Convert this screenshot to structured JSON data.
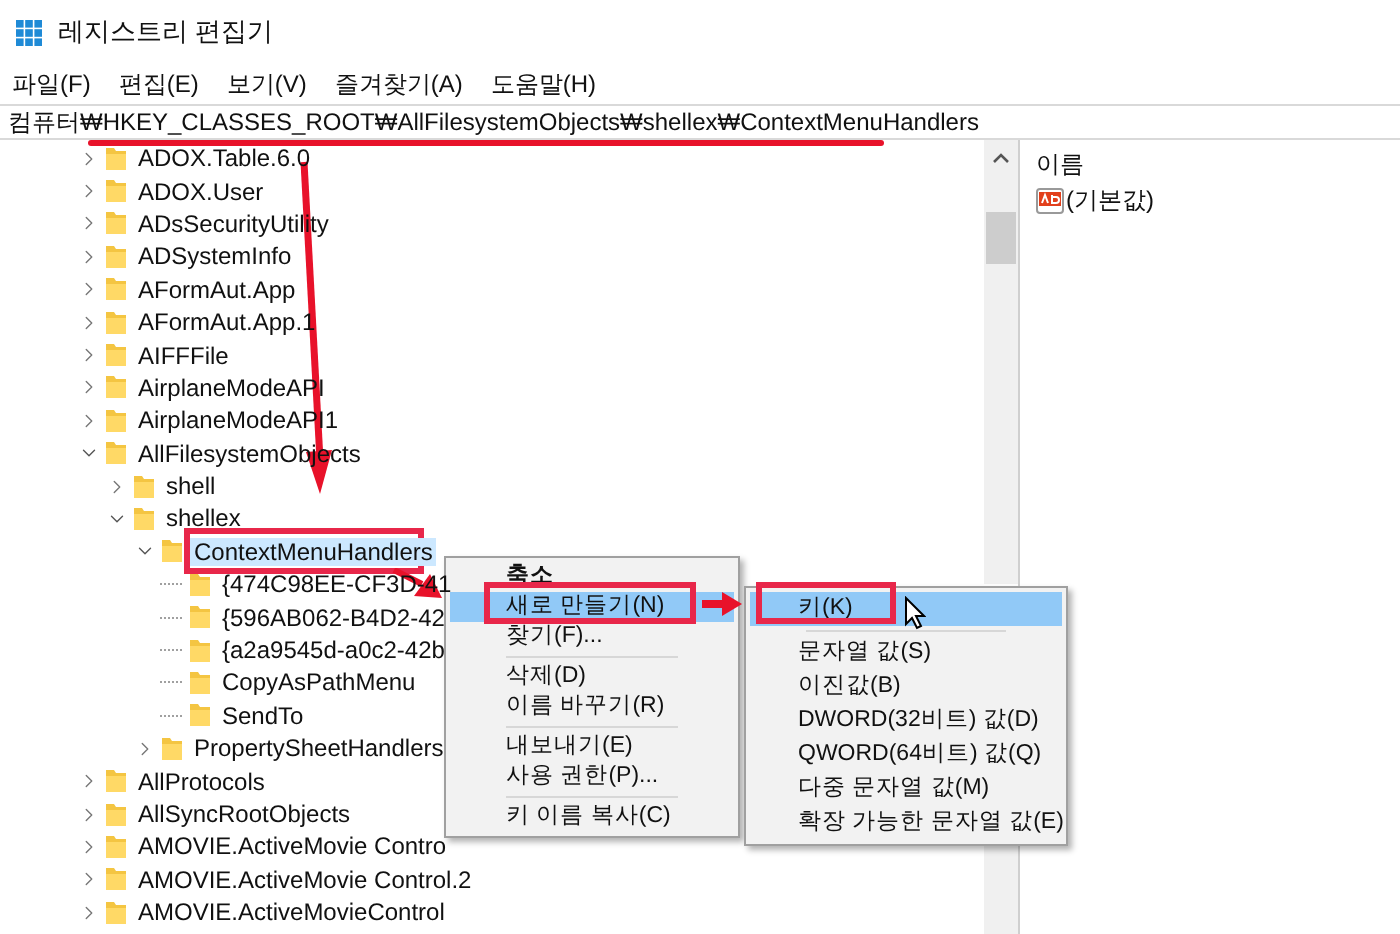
{
  "window": {
    "title": "레지스트리 편집기"
  },
  "menu_bar": [
    "파일(F)",
    "편집(E)",
    "보기(V)",
    "즐겨찾기(A)",
    "도움말(H)"
  ],
  "address": "컴퓨터₩HKEY_CLASSES_ROOT₩AllFilesystemObjects₩shellex₩ContextMenuHandlers",
  "tree": {
    "items": [
      {
        "label": "ADOX.Table.6.0",
        "kind": "branch",
        "expanded": false,
        "selected": false
      },
      {
        "label": "ADOX.User",
        "kind": "branch",
        "expanded": false,
        "selected": false
      },
      {
        "label": "ADsSecurityUtility",
        "kind": "branch",
        "expanded": false,
        "selected": false
      },
      {
        "label": "ADSystemInfo",
        "kind": "branch",
        "expanded": false,
        "selected": false
      },
      {
        "label": "AFormAut.App",
        "kind": "branch",
        "expanded": false,
        "selected": false
      },
      {
        "label": "AFormAut.App.1",
        "kind": "branch",
        "expanded": false,
        "selected": false
      },
      {
        "label": "AIFFFile",
        "kind": "branch",
        "expanded": false,
        "selected": false
      },
      {
        "label": "AirplaneModeAPI",
        "kind": "branch",
        "expanded": false,
        "selected": false
      },
      {
        "label": "AirplaneModeAPI1",
        "kind": "branch",
        "expanded": false,
        "selected": false
      },
      {
        "label": "AllFilesystemObjects",
        "kind": "branch",
        "expanded": true,
        "selected": false,
        "children": [
          {
            "label": "shell",
            "kind": "branch",
            "expanded": false,
            "selected": false
          },
          {
            "label": "shellex",
            "kind": "branch",
            "expanded": true,
            "selected": false,
            "children": [
              {
                "label": "ContextMenuHandlers",
                "kind": "branch",
                "expanded": true,
                "selected": true,
                "children": [
                  {
                    "label": "{474C98EE-CF3D-41",
                    "kind": "leaf",
                    "selected": false
                  },
                  {
                    "label": "{596AB062-B4D2-42",
                    "kind": "leaf",
                    "selected": false
                  },
                  {
                    "label": "{a2a9545d-a0c2-42b",
                    "kind": "leaf",
                    "selected": false
                  },
                  {
                    "label": "CopyAsPathMenu",
                    "kind": "leaf",
                    "selected": false
                  },
                  {
                    "label": "SendTo",
                    "kind": "leaf",
                    "selected": false
                  }
                ]
              },
              {
                "label": "PropertySheetHandlers",
                "kind": "branch",
                "expanded": false,
                "selected": false
              }
            ]
          }
        ]
      },
      {
        "label": "AllProtocols",
        "kind": "branch",
        "expanded": false,
        "selected": false
      },
      {
        "label": "AllSyncRootObjects",
        "kind": "branch",
        "expanded": false,
        "selected": false
      },
      {
        "label": "AMOVIE.ActiveMovie Contro",
        "kind": "branch",
        "expanded": false,
        "selected": false
      },
      {
        "label": "AMOVIE.ActiveMovie Control.2",
        "kind": "branch",
        "expanded": false,
        "selected": false
      },
      {
        "label": "AMOVIE.ActiveMovieControl",
        "kind": "branch",
        "expanded": false,
        "selected": false
      }
    ]
  },
  "values_pane": {
    "column": "이름",
    "rows": [
      {
        "name": "(기본값)"
      }
    ]
  },
  "context_menu": {
    "groups": [
      [
        {
          "label": "축소",
          "default": true,
          "selected": false
        },
        {
          "label": "새로 만들기(N)",
          "default": false,
          "selected": true
        },
        {
          "label": "찾기(F)...",
          "default": false,
          "selected": false
        }
      ],
      [
        {
          "label": "삭제(D)",
          "default": false,
          "selected": false
        },
        {
          "label": "이름 바꾸기(R)",
          "default": false,
          "selected": false
        }
      ],
      [
        {
          "label": "내보내기(E)",
          "default": false,
          "selected": false
        },
        {
          "label": "사용 권한(P)...",
          "default": false,
          "selected": false
        }
      ],
      [
        {
          "label": "키 이름 복사(C)",
          "default": false,
          "selected": false
        }
      ]
    ]
  },
  "submenu": {
    "groups": [
      [
        {
          "label": "키(K)",
          "selected": true
        }
      ],
      [
        {
          "label": "문자열 값(S)",
          "selected": false
        },
        {
          "label": "이진값(B)",
          "selected": false
        },
        {
          "label": "DWORD(32비트) 값(D)",
          "selected": false
        },
        {
          "label": "QWORD(64비트) 값(Q)",
          "selected": false
        },
        {
          "label": "다중 문자열 값(M)",
          "selected": false
        },
        {
          "label": "확장 가능한 문자열 값(E)",
          "selected": false
        }
      ]
    ]
  }
}
